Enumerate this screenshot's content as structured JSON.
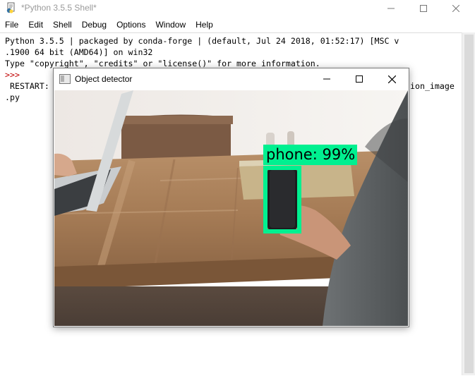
{
  "shell": {
    "title": "*Python 3.5.5 Shell*",
    "menu": [
      "File",
      "Edit",
      "Shell",
      "Debug",
      "Options",
      "Window",
      "Help"
    ],
    "lines": [
      "Python 3.5.5 | packaged by conda-forge | (default, Jul 24 2018, 01:52:17) [MSC v",
      ".1900 64 bit (AMD64)] on win32",
      "Type \"copyright\", \"credits\" or \"license()\" for more information."
    ],
    "prompt": ">>>",
    "restart_left": " RESTART:",
    "restart_right": "ion_image",
    "restart_cont": ".py"
  },
  "detector": {
    "title": "Object detector",
    "detection": {
      "label": "phone: 99%",
      "box_color": "#00f090"
    }
  },
  "colors": {
    "prompt": "#c00000",
    "box": "#00f090"
  },
  "icons": [
    "python-idle-icon",
    "minimize-icon",
    "maximize-icon",
    "close-icon",
    "window-icon"
  ]
}
